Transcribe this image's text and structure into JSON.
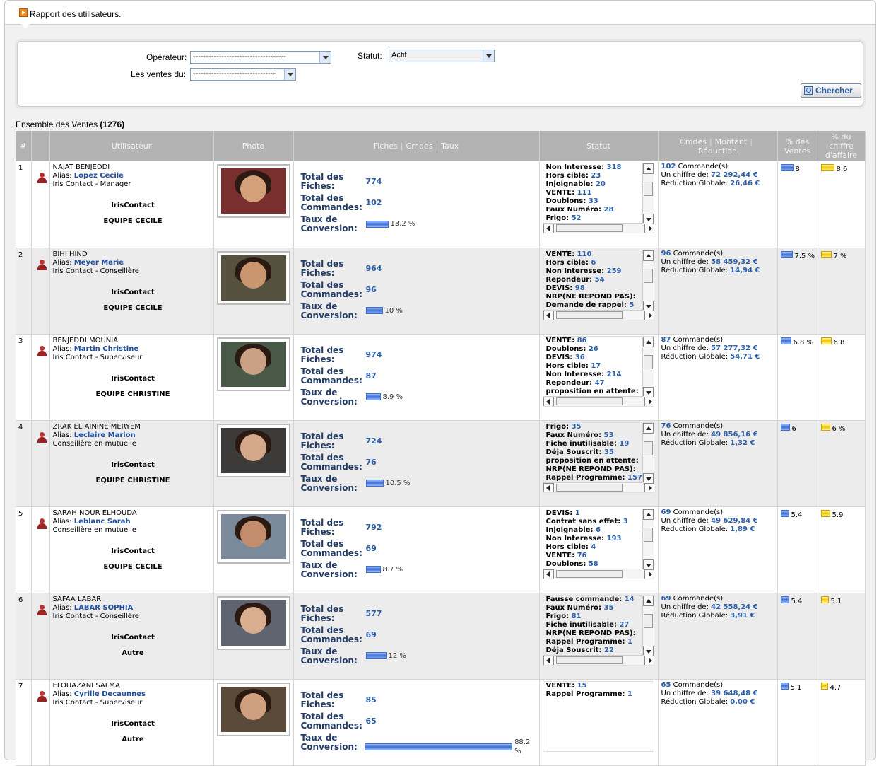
{
  "window": {
    "title": "Rapport des utilisateurs."
  },
  "filters": {
    "operateur_label": "Opérateur:",
    "operateur_value": "------------------------------------",
    "ventes_label": "Les ventes du:",
    "ventes_value": "--------------------------------",
    "statut_label": "Statut:",
    "statut_value": "Actif",
    "search_label": "Chercher"
  },
  "summary": {
    "label": "Ensemble des Ventes",
    "count": "(1276)"
  },
  "headers": {
    "hash": "#",
    "user": "Utilisateur",
    "photo": "Photo",
    "fiches": "Fiches",
    "cmdes": "Cmdes",
    "taux": "Taux",
    "statut": "Statut",
    "cmdes2": "Cmdes",
    "montant": "Montant",
    "reduction": "Réduction",
    "pct_ventes": "% des Ventes",
    "pct_ca": "% du chiffre d'affaire"
  },
  "labels": {
    "total_fiches": "Total des Fiches:",
    "total_cmds": "Total des Commandes:",
    "taux": "Taux de Conversion:",
    "commandes": "Commande(s)",
    "un_chiffre": "Un chiffre de:",
    "reduction_globale": "Réduction Globale:"
  },
  "colors": {
    "header_bg": "#b3b3b3",
    "link": "#2b5faa",
    "bar_blue": "#3d6fd6",
    "bar_yellow": "#f0c600"
  },
  "rows": [
    {
      "n": "1",
      "name": "NAJAT BENJEDDI",
      "alias": "Lopez Cecile",
      "role": "Iris Contact - Manager",
      "org": "IrisContact",
      "team": "EQUIPE CECILE",
      "fiches": "774",
      "cmds": "102",
      "taux": "13.2 %",
      "taux_val": 13.2,
      "status": [
        [
          "Non Interesse:",
          "318"
        ],
        [
          "Hors cible:",
          "23"
        ],
        [
          "Injoignable:",
          "20"
        ],
        [
          "VENTE:",
          "111"
        ],
        [
          "Doublons:",
          "33"
        ],
        [
          "Faux Numéro:",
          "28"
        ],
        [
          "Frigo:",
          "52"
        ]
      ],
      "cmd_count": "102",
      "montant": "72 292,44 €",
      "reduction": "26,46 €",
      "pv": "8",
      "pca": "8.6",
      "pv_val": 8,
      "pca_val": 8.6
    },
    {
      "n": "2",
      "name": "BIHI HIND",
      "alias": "Meyer Marie",
      "role": "Iris Contact - Conseillère",
      "org": "IrisContact",
      "team": "EQUIPE CECILE",
      "fiches": "964",
      "cmds": "96",
      "taux": "10 %",
      "taux_val": 10,
      "status": [
        [
          "VENTE:",
          "110"
        ],
        [
          "Hors cible:",
          "6"
        ],
        [
          "Non Interesse:",
          "259"
        ],
        [
          "Repondeur:",
          "54"
        ],
        [
          "DEVIS:",
          "98"
        ],
        [
          "NRP(NE REPOND PAS):",
          ""
        ],
        [
          "Demande de rappel:",
          "5"
        ]
      ],
      "cmd_count": "96",
      "montant": "58 459,32 €",
      "reduction": "14,94 €",
      "pv": "7.5 %",
      "pca": "7 %",
      "pv_val": 7.5,
      "pca_val": 7
    },
    {
      "n": "3",
      "name": "BENJEDDI MOUNIA",
      "alias": "Martin Christine",
      "role": "Iris Contact - Superviseur",
      "org": "IrisContact",
      "team": "EQUIPE CHRISTINE",
      "fiches": "974",
      "cmds": "87",
      "taux": "8.9 %",
      "taux_val": 8.9,
      "status": [
        [
          "VENTE:",
          "86"
        ],
        [
          "Doublons:",
          "26"
        ],
        [
          "DEVIS:",
          "36"
        ],
        [
          "Hors cible:",
          "17"
        ],
        [
          "Non Interesse:",
          "214"
        ],
        [
          "Repondeur:",
          "47"
        ],
        [
          "proposition en attente:",
          ""
        ]
      ],
      "cmd_count": "87",
      "montant": "57 277,32 €",
      "reduction": "54,71 €",
      "pv": "6.8 %",
      "pca": "6.8",
      "pv_val": 6.8,
      "pca_val": 6.8
    },
    {
      "n": "4",
      "name": "ZRAK EL AININE MERYEM",
      "alias": "Leclaire Marion",
      "role": "Conseillère en mutuelle",
      "org": "IrisContact",
      "team": "EQUIPE CHRISTINE",
      "fiches": "724",
      "cmds": "76",
      "taux": "10.5 %",
      "taux_val": 10.5,
      "status": [
        [
          "Frigo:",
          "35"
        ],
        [
          "Faux Numéro:",
          "53"
        ],
        [
          "Fiche inutilisable:",
          "19"
        ],
        [
          "Déja Souscrit:",
          "35"
        ],
        [
          "proposition en attente:",
          ""
        ],
        [
          "NRP(NE REPOND PAS):",
          ""
        ],
        [
          "Rappel Programme:",
          "157"
        ]
      ],
      "cmd_count": "76",
      "montant": "49 856,16 €",
      "reduction": "1,32 €",
      "pv": "6",
      "pca": "6 %",
      "pv_val": 6,
      "pca_val": 6
    },
    {
      "n": "5",
      "name": "SARAH NOUR ELHOUDA",
      "alias": "Leblanc Sarah",
      "role": "Conseillère en mutuelle",
      "org": "IrisContact",
      "team": "EQUIPE CECILE",
      "fiches": "792",
      "cmds": "69",
      "taux": "8.7 %",
      "taux_val": 8.7,
      "status": [
        [
          "DEVIS:",
          "1"
        ],
        [
          "Contrat sans effet:",
          "3"
        ],
        [
          "Injoignable:",
          "6"
        ],
        [
          "Non Interesse:",
          "193"
        ],
        [
          "Hors cible:",
          "4"
        ],
        [
          "VENTE:",
          "76"
        ],
        [
          "Doublons:",
          "58"
        ]
      ],
      "cmd_count": "69",
      "montant": "49 629,84 €",
      "reduction": "1,89 €",
      "pv": "5.4",
      "pca": "5.9",
      "pv_val": 5.4,
      "pca_val": 5.9
    },
    {
      "n": "6",
      "name": "SAFAA LABAR",
      "alias": "LABAR SOPHIA",
      "role": "Iris Contact - Conseillère",
      "org": "IrisContact",
      "team": "Autre",
      "fiches": "577",
      "cmds": "69",
      "taux": "12 %",
      "taux_val": 12,
      "status": [
        [
          "Fausse commande:",
          "14"
        ],
        [
          "Faux Numéro:",
          "35"
        ],
        [
          "Frigo:",
          "81"
        ],
        [
          "Fiche inutilisable:",
          "27"
        ],
        [
          "NRP(NE REPOND PAS):",
          ""
        ],
        [
          "Rappel Programme:",
          "1"
        ],
        [
          "Déja Souscrit:",
          "22"
        ]
      ],
      "cmd_count": "69",
      "montant": "42 558,24 €",
      "reduction": "3,91 €",
      "pv": "5.4",
      "pca": "5.1",
      "pv_val": 5.4,
      "pca_val": 5.1
    },
    {
      "n": "7",
      "name": "ELOUAZANI SALMA",
      "alias": "Cyrille Decaunnes",
      "role": "Iris Contact - Superviseur",
      "org": "IrisContact",
      "team": "Autre",
      "fiches": "85",
      "cmds": "65",
      "taux": "88.2 %",
      "taux_val": 88.2,
      "status": [
        [
          "VENTE:",
          "15"
        ],
        [
          "Rappel Programme:",
          "1"
        ]
      ],
      "cmd_count": "65",
      "montant": "39 648,48 €",
      "reduction": "0,00 €",
      "pv": "5.1",
      "pca": "4.7",
      "pv_val": 5.1,
      "pca_val": 4.7
    }
  ]
}
